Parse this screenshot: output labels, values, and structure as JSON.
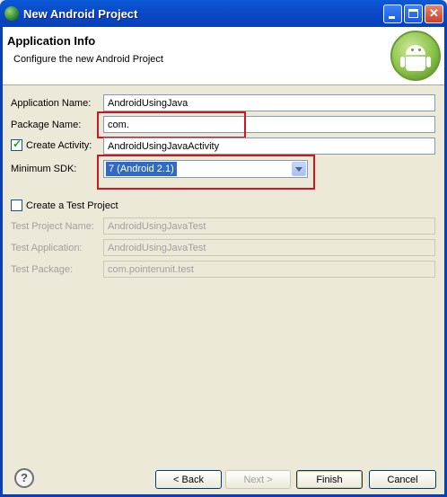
{
  "window": {
    "title": "New Android Project"
  },
  "header": {
    "title": "Application Info",
    "subtitle": "Configure the new Android Project"
  },
  "form": {
    "application_name": {
      "label": "Application Name:",
      "value": "AndroidUsingJava"
    },
    "package_name": {
      "label": "Package Name:",
      "value": "com."
    },
    "create_activity": {
      "label": "Create Activity:",
      "checked": true,
      "value": "AndroidUsingJavaActivity"
    },
    "minimum_sdk": {
      "label": "Minimum SDK:",
      "selected": "7 (Android 2.1)"
    },
    "create_test_project": {
      "label": "Create a Test Project",
      "checked": false
    },
    "test_project_name": {
      "label": "Test Project Name:",
      "value": "AndroidUsingJavaTest"
    },
    "test_application": {
      "label": "Test Application:",
      "value": "AndroidUsingJavaTest"
    },
    "test_package": {
      "label": "Test Package:",
      "value": "com.pointerunit.test"
    }
  },
  "buttons": {
    "help": "?",
    "back": "< Back",
    "next": "Next >",
    "finish": "Finish",
    "cancel": "Cancel"
  },
  "colors": {
    "titlebar": "#0b47c6",
    "dialog_bg": "#ece9d8",
    "highlight": "#d7141a",
    "selection": "#316ac5"
  },
  "icons": {
    "app": "eclipse-android-icon",
    "logo": "android-robot-icon",
    "help": "help-icon"
  }
}
